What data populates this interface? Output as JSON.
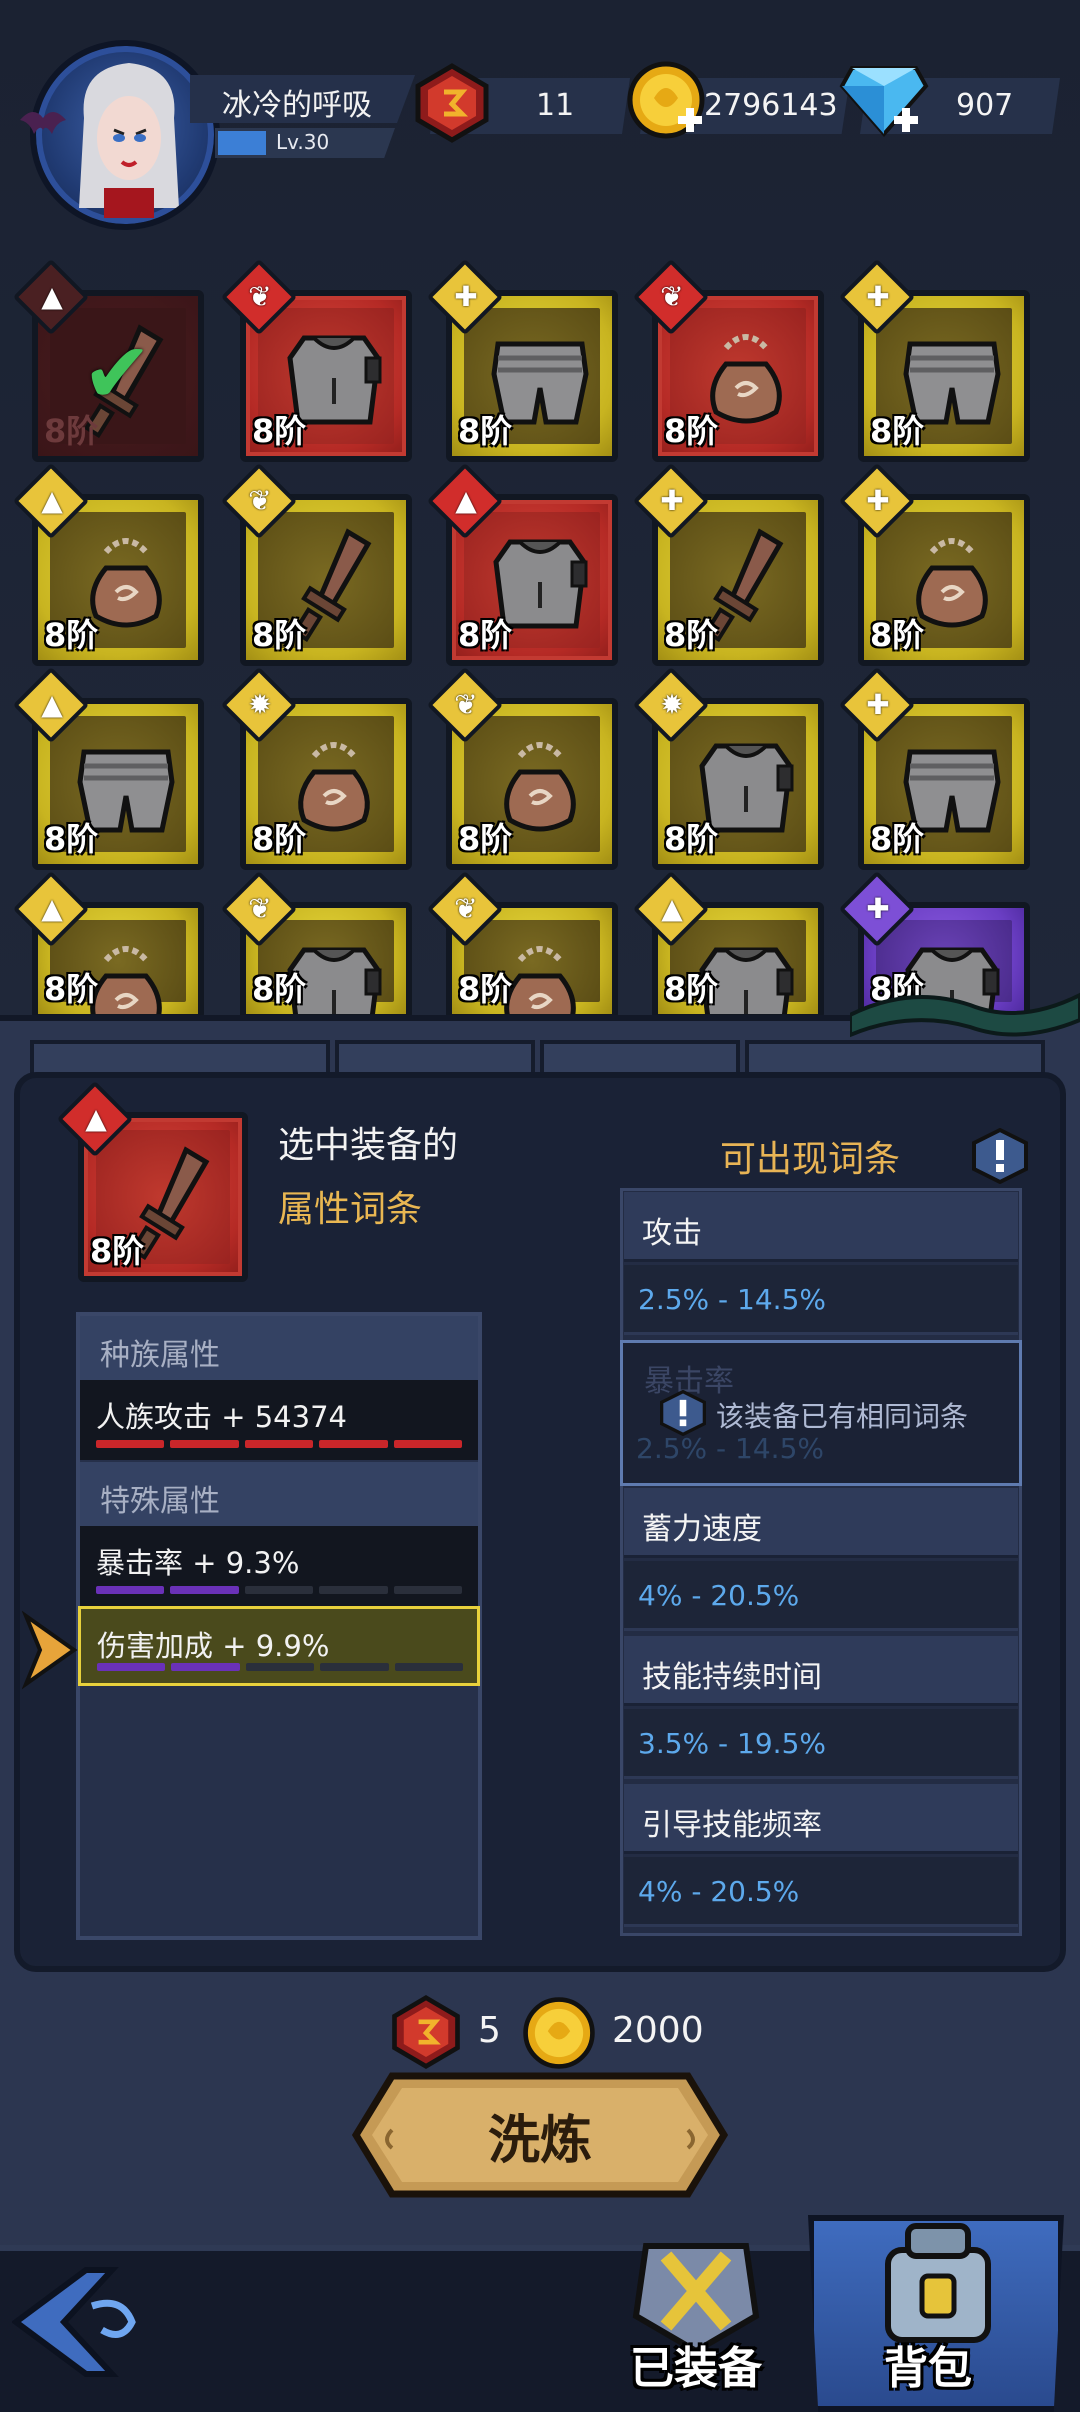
{
  "player": {
    "name": "冰冷的呼吸",
    "level": "Lv.30",
    "level_progress": 0.28
  },
  "resources": [
    {
      "icon": "red-rune-gem-icon",
      "value": "11"
    },
    {
      "icon": "gold-coin-icon",
      "value": "2796143"
    },
    {
      "icon": "blue-diamond-icon",
      "value": "907"
    }
  ],
  "inventory": {
    "tier_label": "8阶",
    "items": [
      {
        "rarity": "dim",
        "type": "sword",
        "badge": "helmet-icon",
        "equipped": true
      },
      {
        "rarity": "red",
        "type": "armor",
        "badge": "wing-icon"
      },
      {
        "rarity": "yellow",
        "type": "pants",
        "badge": "wrench-icon"
      },
      {
        "rarity": "red",
        "type": "pouch",
        "badge": "wing-icon"
      },
      {
        "rarity": "yellow",
        "type": "pants",
        "badge": "wrench-icon"
      },
      {
        "rarity": "yellow",
        "type": "pouch",
        "badge": "helmet-icon"
      },
      {
        "rarity": "yellow",
        "type": "sword",
        "badge": "wing-icon"
      },
      {
        "rarity": "red",
        "type": "armor",
        "badge": "helmet-icon"
      },
      {
        "rarity": "yellow",
        "type": "sword",
        "badge": "wrench-icon"
      },
      {
        "rarity": "yellow",
        "type": "pouch",
        "badge": "wrench-icon"
      },
      {
        "rarity": "yellow",
        "type": "pants",
        "badge": "helmet-icon"
      },
      {
        "rarity": "yellow",
        "type": "pouch",
        "badge": "flame-icon"
      },
      {
        "rarity": "yellow",
        "type": "pouch",
        "badge": "wing-icon"
      },
      {
        "rarity": "yellow",
        "type": "armor",
        "badge": "flame-icon"
      },
      {
        "rarity": "yellow",
        "type": "pants",
        "badge": "wrench-icon"
      },
      {
        "rarity": "yellow",
        "type": "pouch",
        "badge": "helmet-icon"
      },
      {
        "rarity": "yellow",
        "type": "armor",
        "badge": "wing-icon"
      },
      {
        "rarity": "yellow",
        "type": "pouch",
        "badge": "wing-icon"
      },
      {
        "rarity": "yellow",
        "type": "armor",
        "badge": "helmet-icon"
      },
      {
        "rarity": "purple",
        "type": "armor",
        "badge": "wrench-icon"
      }
    ]
  },
  "selected": {
    "title_line1": "选中装备的",
    "title_line2": "属性词条",
    "tier": "8阶",
    "race_header": "种族属性",
    "race_attr": "人族攻击 + 54374",
    "race_segments_filled": 5,
    "special_header": "特殊属性",
    "special_attrs": [
      {
        "text": "暴击率 + 9.3%",
        "segments_filled": 2,
        "selected": false
      },
      {
        "text": "伤害加成 + 9.9%",
        "segments_filled": 2,
        "selected": true
      }
    ]
  },
  "available": {
    "title": "可出现词条",
    "entries": [
      {
        "name": "攻击",
        "range": "2.5% - 14.5%"
      },
      {
        "name": "暴击率",
        "range": "2.5% - 14.5%",
        "duplicate": true
      },
      {
        "name": "蓄力速度",
        "range": "4% - 20.5%"
      },
      {
        "name": "技能持续时间",
        "range": "3.5% - 19.5%"
      },
      {
        "name": "引导技能频率",
        "range": "4% - 20.5%"
      }
    ],
    "duplicate_message": "该装备已有相同词条"
  },
  "cost": {
    "gem": "5",
    "gold": "2000"
  },
  "refine_button": "洗炼",
  "nav": {
    "equipped": "已装备",
    "bag": "背包"
  },
  "colors": {
    "red_rarity": "#c23a32",
    "yellow_rarity": "#d8c42c",
    "purple_rarity": "#6a3ec3",
    "attr_title": "#e8b455",
    "range_text": "#5da9ec"
  }
}
